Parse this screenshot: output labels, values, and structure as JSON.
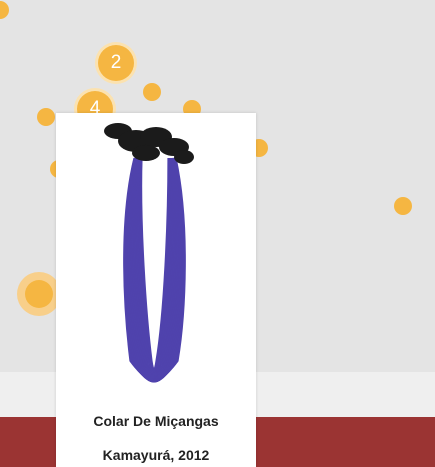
{
  "colors": {
    "map_background": "#e4e4e4",
    "strip": "#efefef",
    "footer": "#9b3433",
    "marker": "#f5b642",
    "cluster_ring": "#fbe2b0",
    "active_halo": "#f8cf8a",
    "necklace_beads": "#3d2fa5",
    "necklace_knot": "#1b1b1b"
  },
  "map": {
    "clusters": [
      {
        "count": "2"
      },
      {
        "count": "4"
      }
    ]
  },
  "popup": {
    "image": {
      "icon": "necklace-image"
    },
    "title": "Colar De Miçangas",
    "subtitle": "Kamayurá, 2012"
  }
}
